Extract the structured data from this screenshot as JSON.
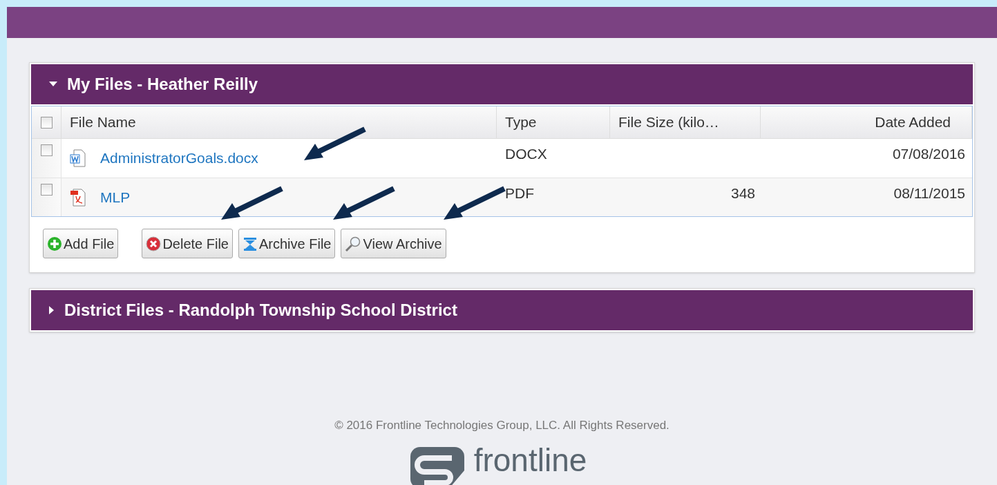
{
  "panels": [
    {
      "title": "My Files - Heather Reilly",
      "expanded": true,
      "table": {
        "header_checked": false,
        "columns": [
          "File Name",
          "Type",
          "File Size (kilo…",
          "Date Added"
        ],
        "rows": [
          {
            "checked": false,
            "kind": "word",
            "name": "AdministratorGoals.docx",
            "type": "DOCX",
            "date": "07/08/2016"
          },
          {
            "checked": false,
            "kind": "pdf",
            "name": "MLP",
            "type": "PDF",
            "size": "348",
            "date": "08/11/2015"
          }
        ]
      },
      "buttons": [
        {
          "kind": "add",
          "label": "Add File"
        },
        {
          "kind": "delete",
          "label": "Delete File"
        },
        {
          "kind": "archive",
          "label": "Archive File"
        },
        {
          "kind": "view",
          "label": "View Archive"
        }
      ]
    },
    {
      "title": "District Files - Randolph Township School District",
      "expanded": false
    }
  ],
  "footer": {
    "copyright": "© 2016 Frontline Technologies Group, LLC. All Rights Reserved.",
    "logo": "frontline"
  }
}
